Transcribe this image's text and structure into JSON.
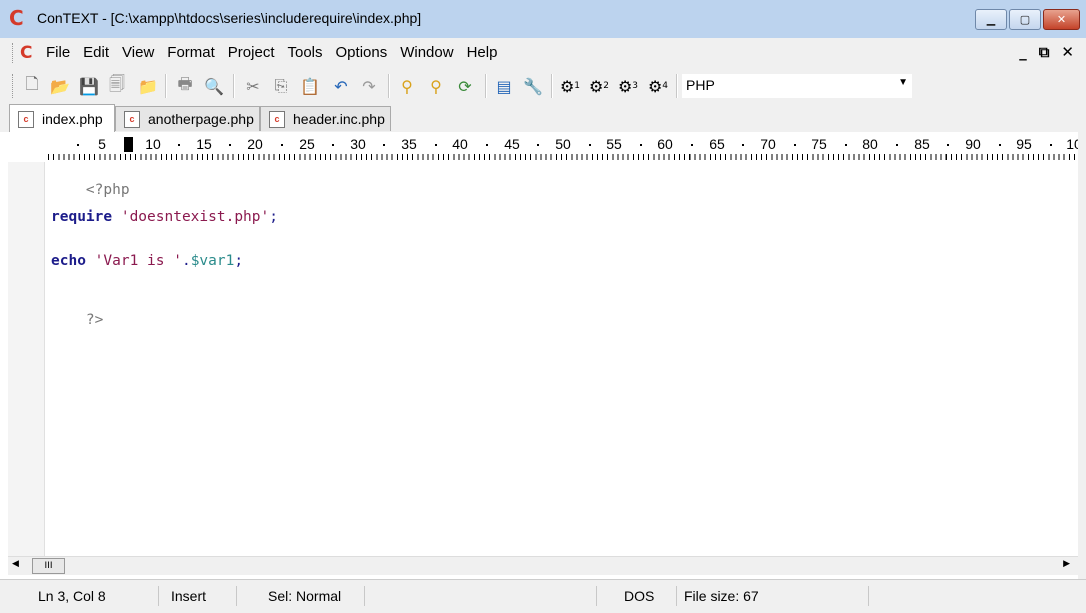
{
  "window": {
    "title": "ConTEXT - [C:\\xampp\\htdocs\\series\\includerequire\\index.php]",
    "app_icon": "context-logo-icon",
    "controls": [
      "minimize",
      "maximize",
      "close"
    ]
  },
  "menu": {
    "items": [
      "File",
      "Edit",
      "View",
      "Format",
      "Project",
      "Tools",
      "Options",
      "Window",
      "Help"
    ],
    "mdi_controls": [
      "_",
      "⧉",
      "✕"
    ]
  },
  "toolbar": {
    "language": "PHP",
    "user_tools": [
      "1",
      "2",
      "3",
      "4"
    ]
  },
  "tabs": [
    {
      "label": "index.php",
      "active": true
    },
    {
      "label": "anotherpage.php",
      "active": false
    },
    {
      "label": "header.inc.php",
      "active": false
    }
  ],
  "ruler": {
    "labels": [
      "5",
      "10",
      "15",
      "20",
      "25",
      "30",
      "35",
      "40",
      "45",
      "50",
      "55",
      "60",
      "65",
      "70",
      "75",
      "80",
      "85",
      "90",
      "95",
      "10"
    ]
  },
  "code": {
    "line1": "<?php",
    "line3_kw": "require",
    "line3_str": "'doesntexist.php'",
    "line3_end": ";",
    "line5_kw": "echo",
    "line5_str": "'Var1 is '",
    "line5_dot": ".",
    "line5_var": "$var1",
    "line5_end": ";",
    "line7": "?>"
  },
  "scrollbar": {
    "thumb_label": "III"
  },
  "status": {
    "position": "Ln 3, Col 8",
    "mode": "Insert",
    "selection": "Sel: Normal",
    "format": "DOS",
    "file_size": "File size: 67"
  }
}
